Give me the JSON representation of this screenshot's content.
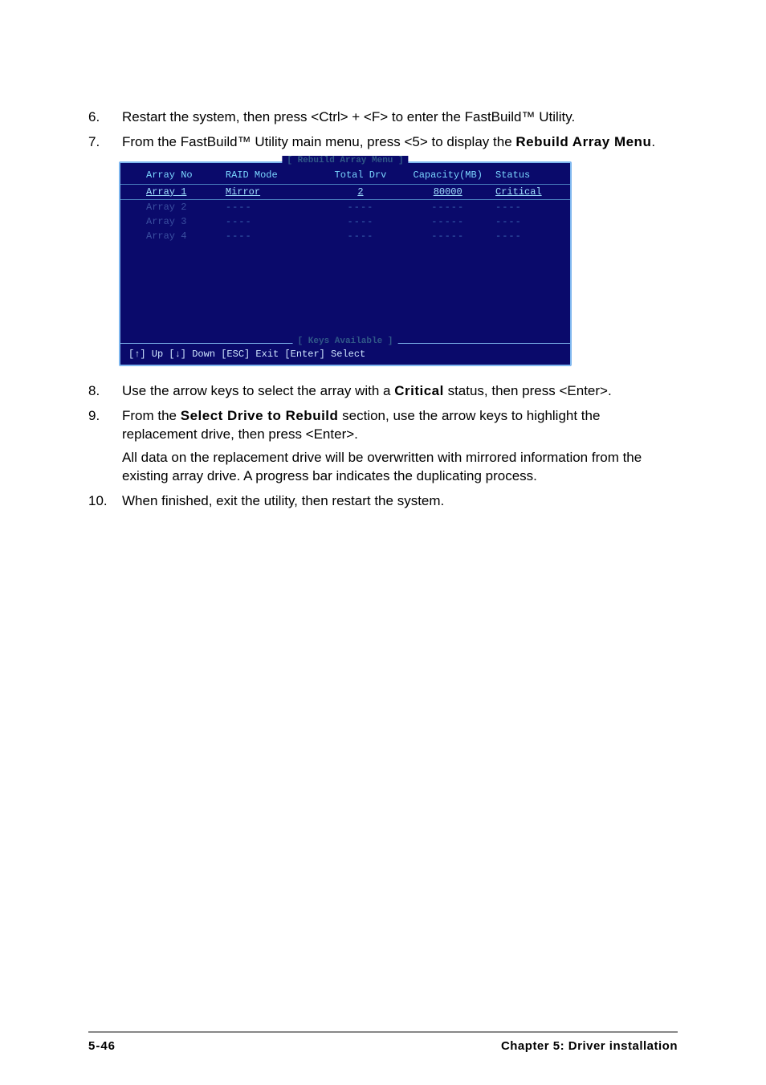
{
  "steps": {
    "i6": {
      "num": "6.",
      "text_a": "Restart the system, then press <Ctrl> + <F> to enter the FastBuild™ Utility."
    },
    "i7": {
      "num": "7.",
      "text_a": "From the FastBuild™ Utility main menu, press <5> to display the ",
      "bold": "Rebuild Array Menu",
      "text_b": "."
    },
    "i8": {
      "num": "8.",
      "text_a": "Use the arrow keys to select the array with a ",
      "bold": "Critical",
      "text_b": " status, then press <Enter>."
    },
    "i9": {
      "num": "9.",
      "text_a": "From the ",
      "bold": "Select Drive to Rebuild",
      "text_b": " section, use the arrow keys to highlight the replacement drive, then press <Enter>.",
      "para2": "All data on the replacement drive will be overwritten with mirrored information from the existing array drive. A progress bar indicates the duplicating process."
    },
    "i10": {
      "num": "10.",
      "text_a": "When finished, exit the utility, then restart the system."
    }
  },
  "bios": {
    "title": "[ Rebuild Array Menu ]",
    "headers": {
      "arr": "Array No",
      "mode": "RAID Mode",
      "total": "Total Drv",
      "cap": "Capacity(MB)",
      "status": "Status"
    },
    "rows": [
      {
        "arr": "Array 1",
        "mode": "Mirror",
        "total": "2",
        "cap": "80000",
        "status": "Critical",
        "hl": true
      },
      {
        "arr": "Array 2",
        "mode": "----",
        "total": "----",
        "cap": "-----",
        "status": "----",
        "hl": false
      },
      {
        "arr": "Array 3",
        "mode": "----",
        "total": "----",
        "cap": "-----",
        "status": "----",
        "hl": false
      },
      {
        "arr": "Array 4",
        "mode": "----",
        "total": "----",
        "cap": "-----",
        "status": "----",
        "hl": false
      }
    ],
    "keys_title": "[ Keys Available ]",
    "keys_line": "[↑] Up   [↓] Down   [ESC] Exit   [Enter] Select"
  },
  "footer": {
    "page": "5-46",
    "chapter": "Chapter 5:  Driver installation"
  }
}
